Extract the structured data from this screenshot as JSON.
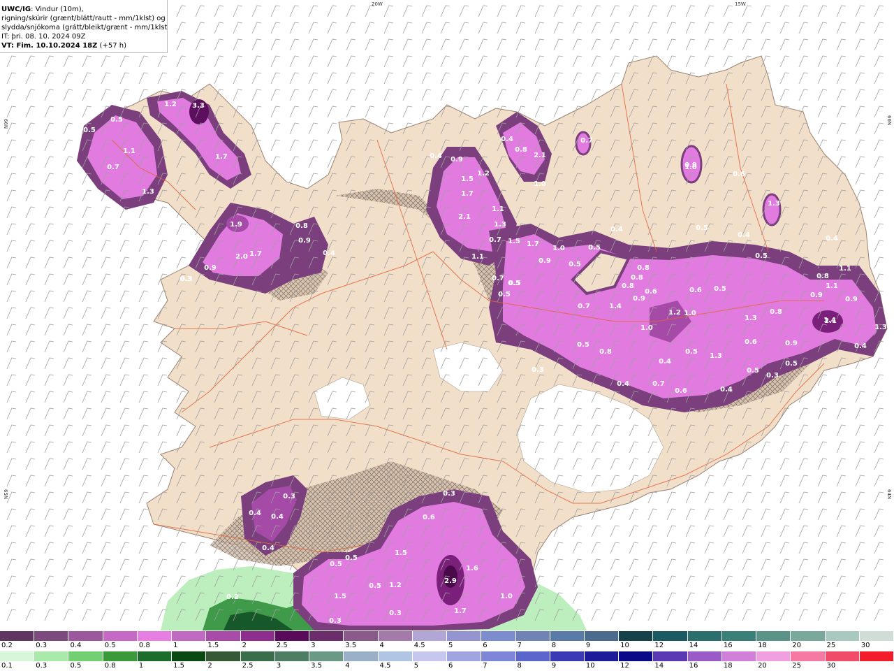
{
  "info": {
    "model": "UWC/IG",
    "desc": ": Vindur (10m),",
    "line2": "rigning/skúrir (grænt/blátt/rautt - mm/1klst) og",
    "line3": "slydda/snjókoma (grátt/bleikt/grænt - mm/1klst)",
    "it": "IT: þri. 08. 10. 2024 09Z",
    "vt": "VT: Fim. 10.10.2024 18Z",
    "lead": " (+57 h)"
  },
  "grid_labels": {
    "top_left": "20W",
    "top_right": "15W",
    "left_top": "66N",
    "left_bottom": "65N",
    "right_top": "66N",
    "right_bottom": "64N"
  },
  "value_labels": [
    {
      "t": "1.2"
    },
    {
      "t": "3.3"
    },
    {
      "t": "0.5"
    },
    {
      "t": "0.5"
    },
    {
      "t": "1.1"
    },
    {
      "t": "0.7"
    },
    {
      "t": "1.3"
    },
    {
      "t": "1.7"
    },
    {
      "t": "1.9"
    },
    {
      "t": "2.0"
    },
    {
      "t": "1.7"
    },
    {
      "t": "0.9"
    },
    {
      "t": "0.3"
    },
    {
      "t": "0.8"
    },
    {
      "t": "0.9"
    },
    {
      "t": "0.4"
    },
    {
      "t": "0.4"
    },
    {
      "t": "0.9"
    },
    {
      "t": "1.5"
    },
    {
      "t": "1.2"
    },
    {
      "t": "1.7"
    },
    {
      "t": "2.1"
    },
    {
      "t": "1.1"
    },
    {
      "t": "1.3"
    },
    {
      "t": "0.7"
    },
    {
      "t": "1.5"
    },
    {
      "t": "1.1"
    },
    {
      "t": "0.7"
    },
    {
      "t": "0.5"
    },
    {
      "t": "0.5"
    },
    {
      "t": "0.5"
    },
    {
      "t": "0.8"
    },
    {
      "t": "2.1"
    },
    {
      "t": "0.4"
    },
    {
      "t": "0.7"
    },
    {
      "t": "1.0"
    },
    {
      "t": "0.9"
    },
    {
      "t": "1.7"
    },
    {
      "t": "1.0"
    },
    {
      "t": "0.9"
    },
    {
      "t": "0.5"
    },
    {
      "t": "0.4"
    },
    {
      "t": "0.5"
    },
    {
      "t": "0.8"
    },
    {
      "t": "0.8"
    },
    {
      "t": "0.8"
    },
    {
      "t": "0.6"
    },
    {
      "t": "0.9"
    },
    {
      "t": "0.7"
    },
    {
      "t": "1.4"
    },
    {
      "t": "1.2"
    },
    {
      "t": "1.0"
    },
    {
      "t": "0.6"
    },
    {
      "t": "0.5"
    },
    {
      "t": "1.0"
    },
    {
      "t": "1.3"
    },
    {
      "t": "0.8"
    },
    {
      "t": "0.6"
    },
    {
      "t": "0.9"
    },
    {
      "t": "0.5"
    },
    {
      "t": "1.3"
    },
    {
      "t": "0.5"
    },
    {
      "t": "0.4"
    },
    {
      "t": "0.3"
    },
    {
      "t": "0.5"
    },
    {
      "t": "0.8"
    },
    {
      "t": "0.4"
    },
    {
      "t": "0.7"
    },
    {
      "t": "0.6"
    },
    {
      "t": "0.4"
    },
    {
      "t": "0.5"
    },
    {
      "t": "0.3"
    },
    {
      "t": "0.9"
    },
    {
      "t": "0.4"
    },
    {
      "t": "1.1"
    },
    {
      "t": "0.8"
    },
    {
      "t": "1.1"
    },
    {
      "t": "0.9"
    },
    {
      "t": "1.4"
    },
    {
      "t": "2.1"
    },
    {
      "t": "1.3"
    },
    {
      "t": "0.4"
    },
    {
      "t": "1.0"
    },
    {
      "t": "0.6"
    },
    {
      "t": "1.3"
    },
    {
      "t": "0.5"
    },
    {
      "t": "0.4"
    },
    {
      "t": "0.5"
    },
    {
      "t": "0.3"
    },
    {
      "t": "0.3"
    },
    {
      "t": "0.6"
    },
    {
      "t": "0.3"
    },
    {
      "t": "0.4"
    },
    {
      "t": "0.4"
    },
    {
      "t": "0.4"
    },
    {
      "t": "0.3"
    },
    {
      "t": "0.5"
    },
    {
      "t": "0.5"
    },
    {
      "t": "1.5"
    },
    {
      "t": "1.2"
    },
    {
      "t": "2.9"
    },
    {
      "t": "1.6"
    },
    {
      "t": "1.5"
    },
    {
      "t": "1.0"
    },
    {
      "t": "1.7"
    },
    {
      "t": "0.3"
    },
    {
      "t": "0.2"
    },
    {
      "t": "0.3"
    },
    {
      "t": "0.5"
    }
  ],
  "legend_top": {
    "labels": [
      "0.2",
      "0.3",
      "0.4",
      "0.5",
      "0.8",
      "1",
      "1.5",
      "2",
      "2.5",
      "3",
      "3.5",
      "4",
      "4.5",
      "5",
      "6",
      "7",
      "8",
      "9",
      "10",
      "12",
      "14",
      "16",
      "18",
      "20",
      "25",
      "30"
    ],
    "colors": [
      "#5e3660",
      "#7d4a7e",
      "#9c589c",
      "#c46ac4",
      "#e77fe3",
      "#c16ac2",
      "#a94ba8",
      "#8d2e8f",
      "#5a0a5a",
      "#6b2d6b",
      "#8a5a8a",
      "#a47aaa",
      "#b2a6d6",
      "#9494d0",
      "#7b8ccf",
      "#6f84b4",
      "#5a7aa8",
      "#4a6a8e",
      "#17414a",
      "#1b5a62",
      "#2a6e6e",
      "#3a8078",
      "#5a9488",
      "#7aa89a",
      "#a8c8c0",
      "#d0dcd6"
    ]
  },
  "legend_bottom": {
    "labels": [
      "0.1",
      "0.3",
      "0.5",
      "0.8",
      "1",
      "1.5",
      "2",
      "2.5",
      "3",
      "3.5",
      "4",
      "4.5",
      "5",
      "6",
      "7",
      "8",
      "9",
      "10",
      "12",
      "14",
      "16",
      "18",
      "20",
      "25",
      "30"
    ],
    "colors": [
      "#d8f6d8",
      "#a9e9a9",
      "#72cf72",
      "#3a9a3a",
      "#1c6d2c",
      "#0a4a12",
      "#355a35",
      "#3a6d4a",
      "#4d7d62",
      "#6a9a86",
      "#9ab0c8",
      "#b0c4e4",
      "#c6c6ee",
      "#a0a4e0",
      "#7e86d8",
      "#5a66cc",
      "#3a3ab4",
      "#1c1c9a",
      "#0a0a88",
      "#5a3ab4",
      "#9a5ac8",
      "#d080d8",
      "#f0a0e0",
      "#f47aa4",
      "#f04c6a",
      "#f21c2a"
    ]
  }
}
